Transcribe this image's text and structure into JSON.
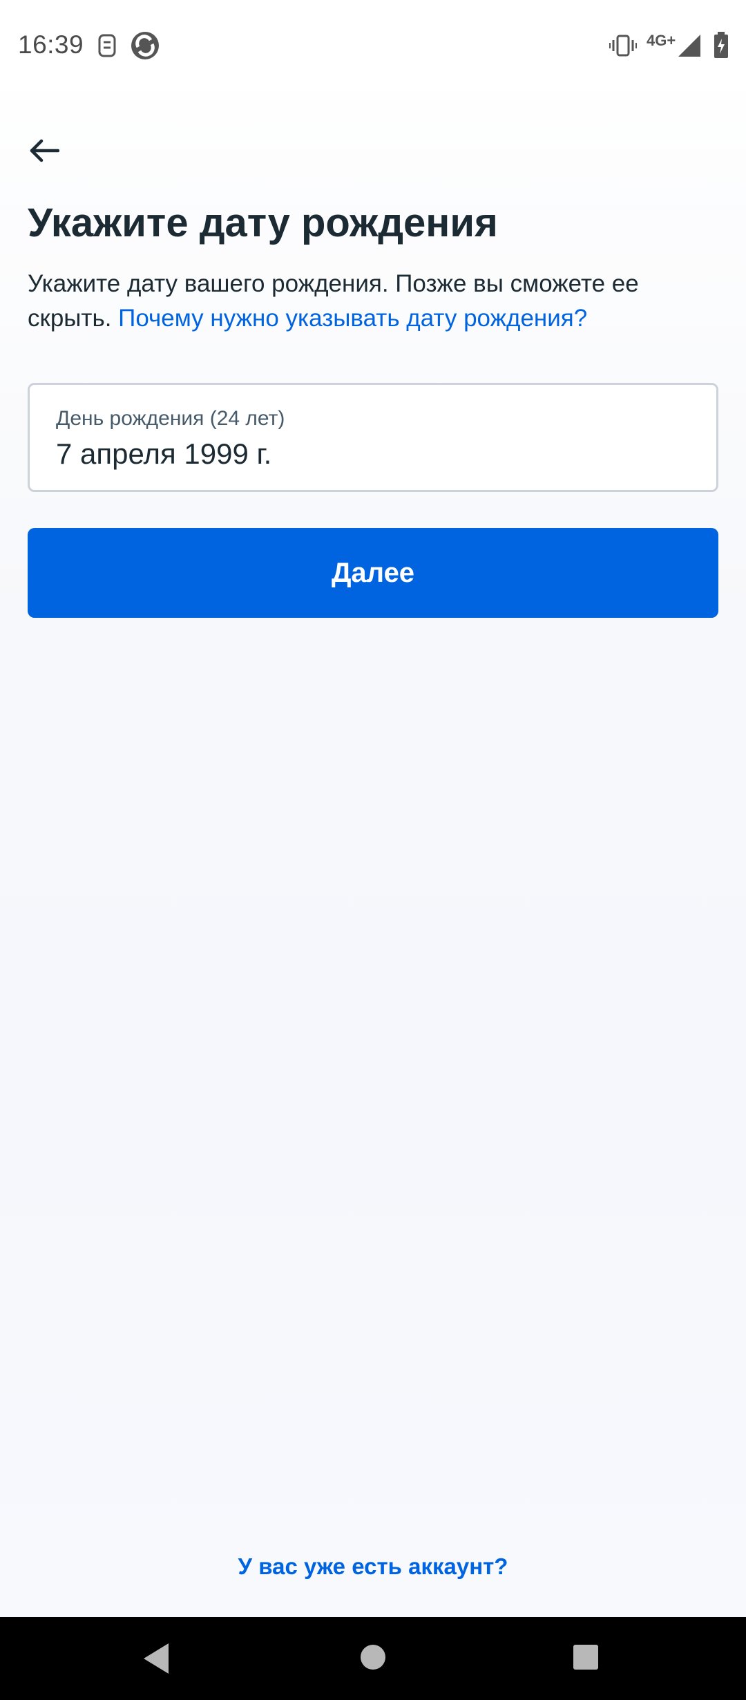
{
  "status_bar": {
    "time": "16:39",
    "network_type": "4G+",
    "icons": [
      "quiz-icon",
      "app-notification-icon",
      "vibrate-icon",
      "signal-icon",
      "battery-charging-icon"
    ]
  },
  "header": {
    "back_icon": "arrow-left-icon",
    "title": "Укажите дату рождения",
    "subtitle_text": "Укажите дату вашего рождения. Позже вы сможете ее скрыть.",
    "subtitle_link": "Почему нужно указывать дату рождения?"
  },
  "birthday_field": {
    "label": "День рождения (24 лет)",
    "value": "7 апреля 1999 г."
  },
  "next_button": {
    "label": "Далее"
  },
  "footer": {
    "have_account_link": "У вас уже есть аккаунт?"
  },
  "navigation": {
    "icons": [
      "nav-back-icon",
      "nav-home-icon",
      "nav-recents-icon"
    ]
  },
  "colors": {
    "accent": "#0064e0",
    "text_primary": "#1c2b33",
    "text_secondary": "#465a69",
    "field_border": "#cbd2d9"
  }
}
